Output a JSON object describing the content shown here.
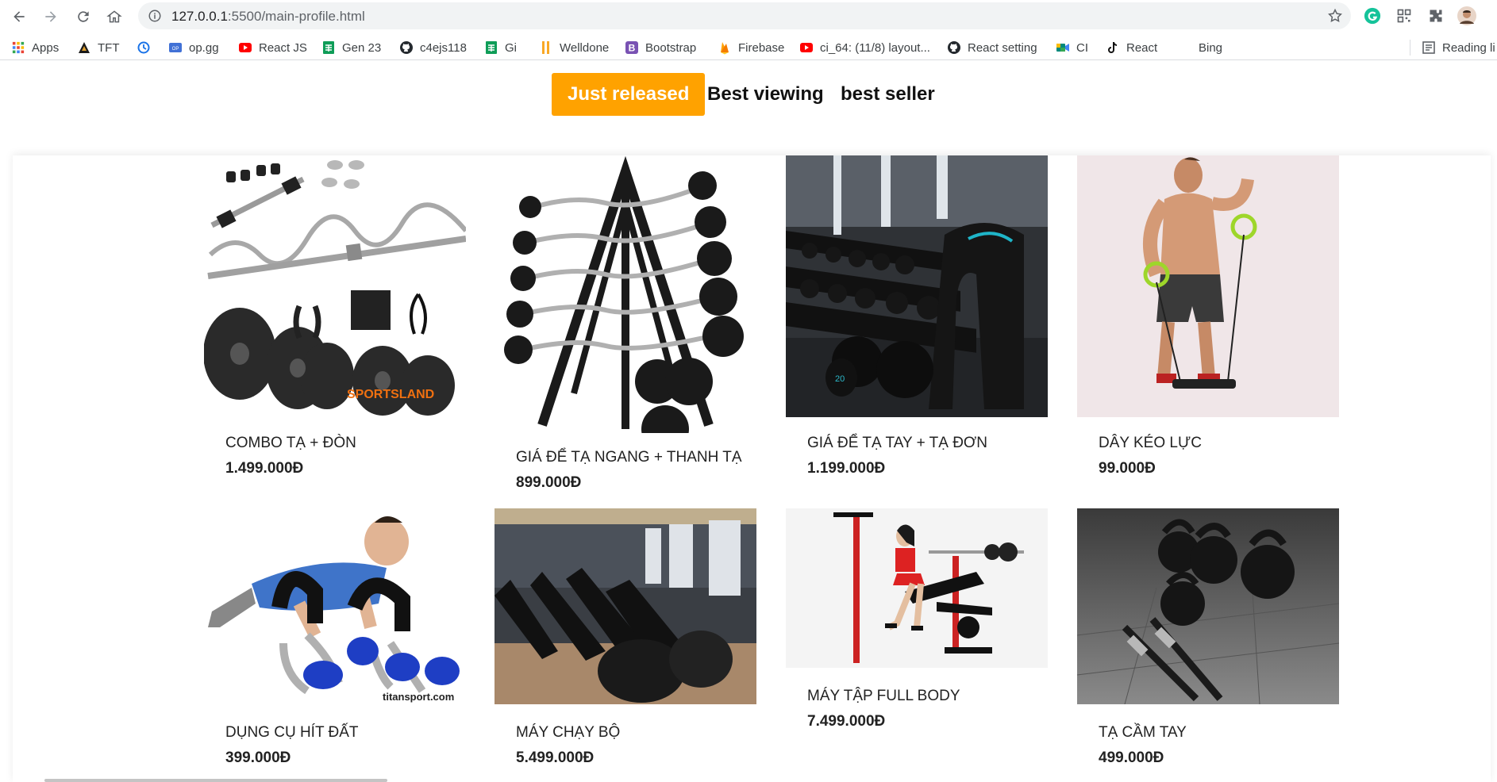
{
  "browser": {
    "url_host": "127.0.0.1",
    "url_path": ":5500/main-profile.html",
    "bookmarks": [
      {
        "label": "Apps",
        "icon": "apps-grid-icon"
      },
      {
        "label": "TFT",
        "icon": "tft-icon"
      },
      {
        "label": "",
        "icon": "history-icon"
      },
      {
        "label": "op.gg",
        "icon": "opgg-icon"
      },
      {
        "label": "React JS",
        "icon": "youtube-icon"
      },
      {
        "label": "Gen 23",
        "icon": "sheets-icon"
      },
      {
        "label": "c4ejs118",
        "icon": "github-icon"
      },
      {
        "label": "Gi",
        "icon": "sheets-icon"
      },
      {
        "label": "Welldone",
        "icon": "welldone-icon"
      },
      {
        "label": "Bootstrap",
        "icon": "bootstrap-icon"
      },
      {
        "label": "Firebase",
        "icon": "firebase-icon"
      },
      {
        "label": "ci_64: (11/8) layout...",
        "icon": "youtube-icon"
      },
      {
        "label": "React setting",
        "icon": "github-icon"
      },
      {
        "label": "CI",
        "icon": "meet-icon"
      },
      {
        "label": "React",
        "icon": "tiktok-icon"
      },
      {
        "label": "Bing",
        "icon": "bing-icon"
      },
      {
        "label": "Reading li",
        "icon": "reading-list-icon"
      }
    ],
    "colors": {
      "omnibox": "#f1f3f4",
      "youtube": "#ff0000",
      "sheets": "#0f9d58",
      "bootstrap": "#7952b3"
    }
  },
  "tabs": [
    {
      "label": "Just released",
      "active": true
    },
    {
      "label": "Best viewing",
      "active": false
    },
    {
      "label": "best seller",
      "active": false
    }
  ],
  "accent_color": "#ffa200",
  "products": [
    {
      "name": "COMBO TẠ + ĐÒN",
      "price": "1.499.000Đ",
      "image": "dumbbell-barbell-combo-image"
    },
    {
      "name": "GIÁ ĐỂ TẠ NGANG + THANH TẠ",
      "price": "899.000Đ",
      "image": "barbell-rack-image"
    },
    {
      "name": "GIÁ ĐỂ TẠ TAY + TẠ ĐƠN",
      "price": "1.199.000Đ",
      "image": "gym-dumbbell-rack-image"
    },
    {
      "name": "DÂY KÉO LỰC",
      "price": "99.000Đ",
      "image": "resistance-band-image"
    },
    {
      "name": "DỤNG CỤ HÍT ĐẤT",
      "price": "399.000Đ",
      "image": "pushup-bars-image",
      "watermark": "titansport.com"
    },
    {
      "name": "MÁY CHẠY BỘ",
      "price": "5.499.000Đ",
      "image": "treadmill-room-image"
    },
    {
      "name": "MÁY TẬP FULL BODY",
      "price": "7.499.000Đ",
      "image": "home-gym-bench-image"
    },
    {
      "name": "TẠ CẦM TAY",
      "price": "499.000Đ",
      "image": "kettlebells-image"
    }
  ]
}
